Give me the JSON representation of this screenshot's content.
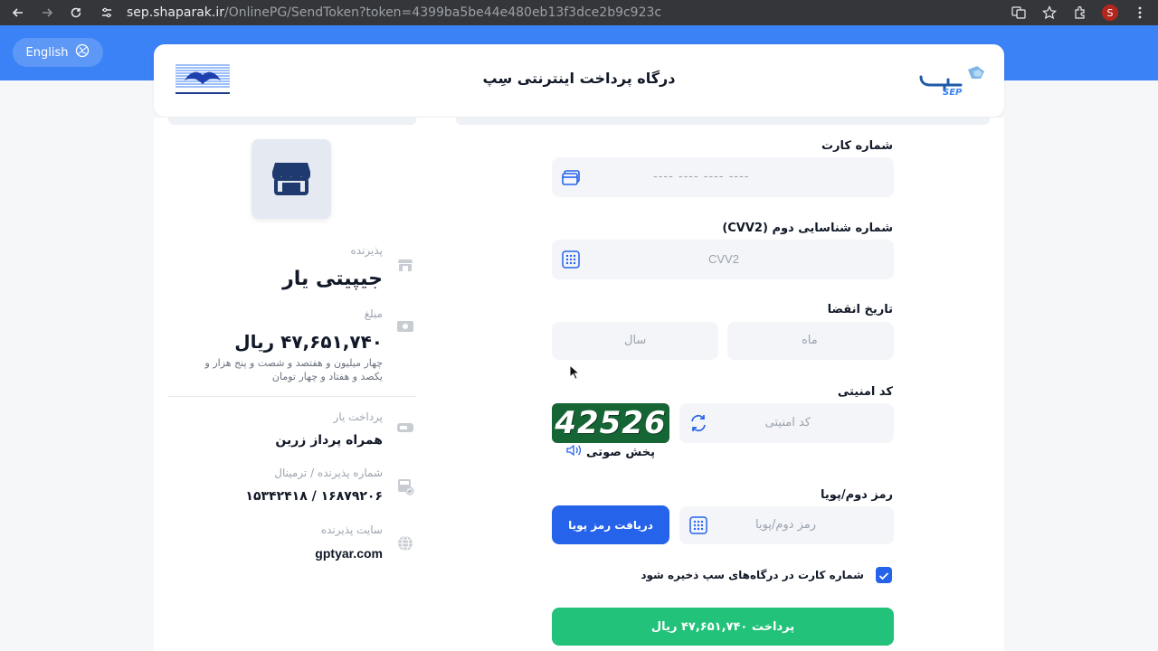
{
  "browser": {
    "url_host": "sep.shaparak.ir",
    "url_path": "/OnlinePG/SendToken?token=4399ba5be44e480eb13f3dce2b9c923c",
    "profile_initial": "S"
  },
  "header": {
    "language_button": "English",
    "title": "درگاه پرداخت اینترنتی سِپ",
    "sep_logo_text": "SEP"
  },
  "merchant": {
    "acceptor_label": "پذیرنده",
    "acceptor_value": "جیپیتی یار",
    "amount_label": "مبلغ",
    "amount_value": "۴۷,۶۵۱,۷۴۰ ریال",
    "amount_words": "چهار میلیون و هفتصد و شصت و پنج هزار و یکصد و هفتاد و چهار تومان",
    "facilitator_label": "پرداخت یار",
    "facilitator_value": "همراه پرداز زرین",
    "terminal_label": "شماره پذیرنده / ترمینال",
    "terminal_value": "۱۶۸۷۹۲۰۶ / ۱۵۳۴۲۴۱۸",
    "site_label": "سایت پذیرنده",
    "site_value": "gptyar.com"
  },
  "form": {
    "card_label": "شماره کارت",
    "card_placeholder": "---- ---- ---- ----",
    "cvv_label": "شماره شناسایی دوم (CVV2)",
    "cvv_placeholder": "CVV2",
    "expiry_label": "تاریخ انقضا",
    "month_placeholder": "ماه",
    "year_placeholder": "سال",
    "captcha_label": "کد امنیتی",
    "captcha_placeholder": "کد امنیتی",
    "captcha_image_text": "42526",
    "audio_label": "پخش صوتی",
    "otp_label": "رمز دوم/پویا",
    "otp_placeholder": "رمز دوم/پویا",
    "otp_button": "دریافت رمز پویا",
    "save_card_label": "شماره کارت در درگاه‌های سپ ذخیره شود",
    "save_card_checked": true,
    "pay_button": "پرداخت ۴۷,۶۵۱,۷۴۰ ریال"
  },
  "colors": {
    "primary": "#2563eb",
    "band": "#3b82f6",
    "pay": "#22c27a",
    "captcha_bg": "#166534"
  }
}
